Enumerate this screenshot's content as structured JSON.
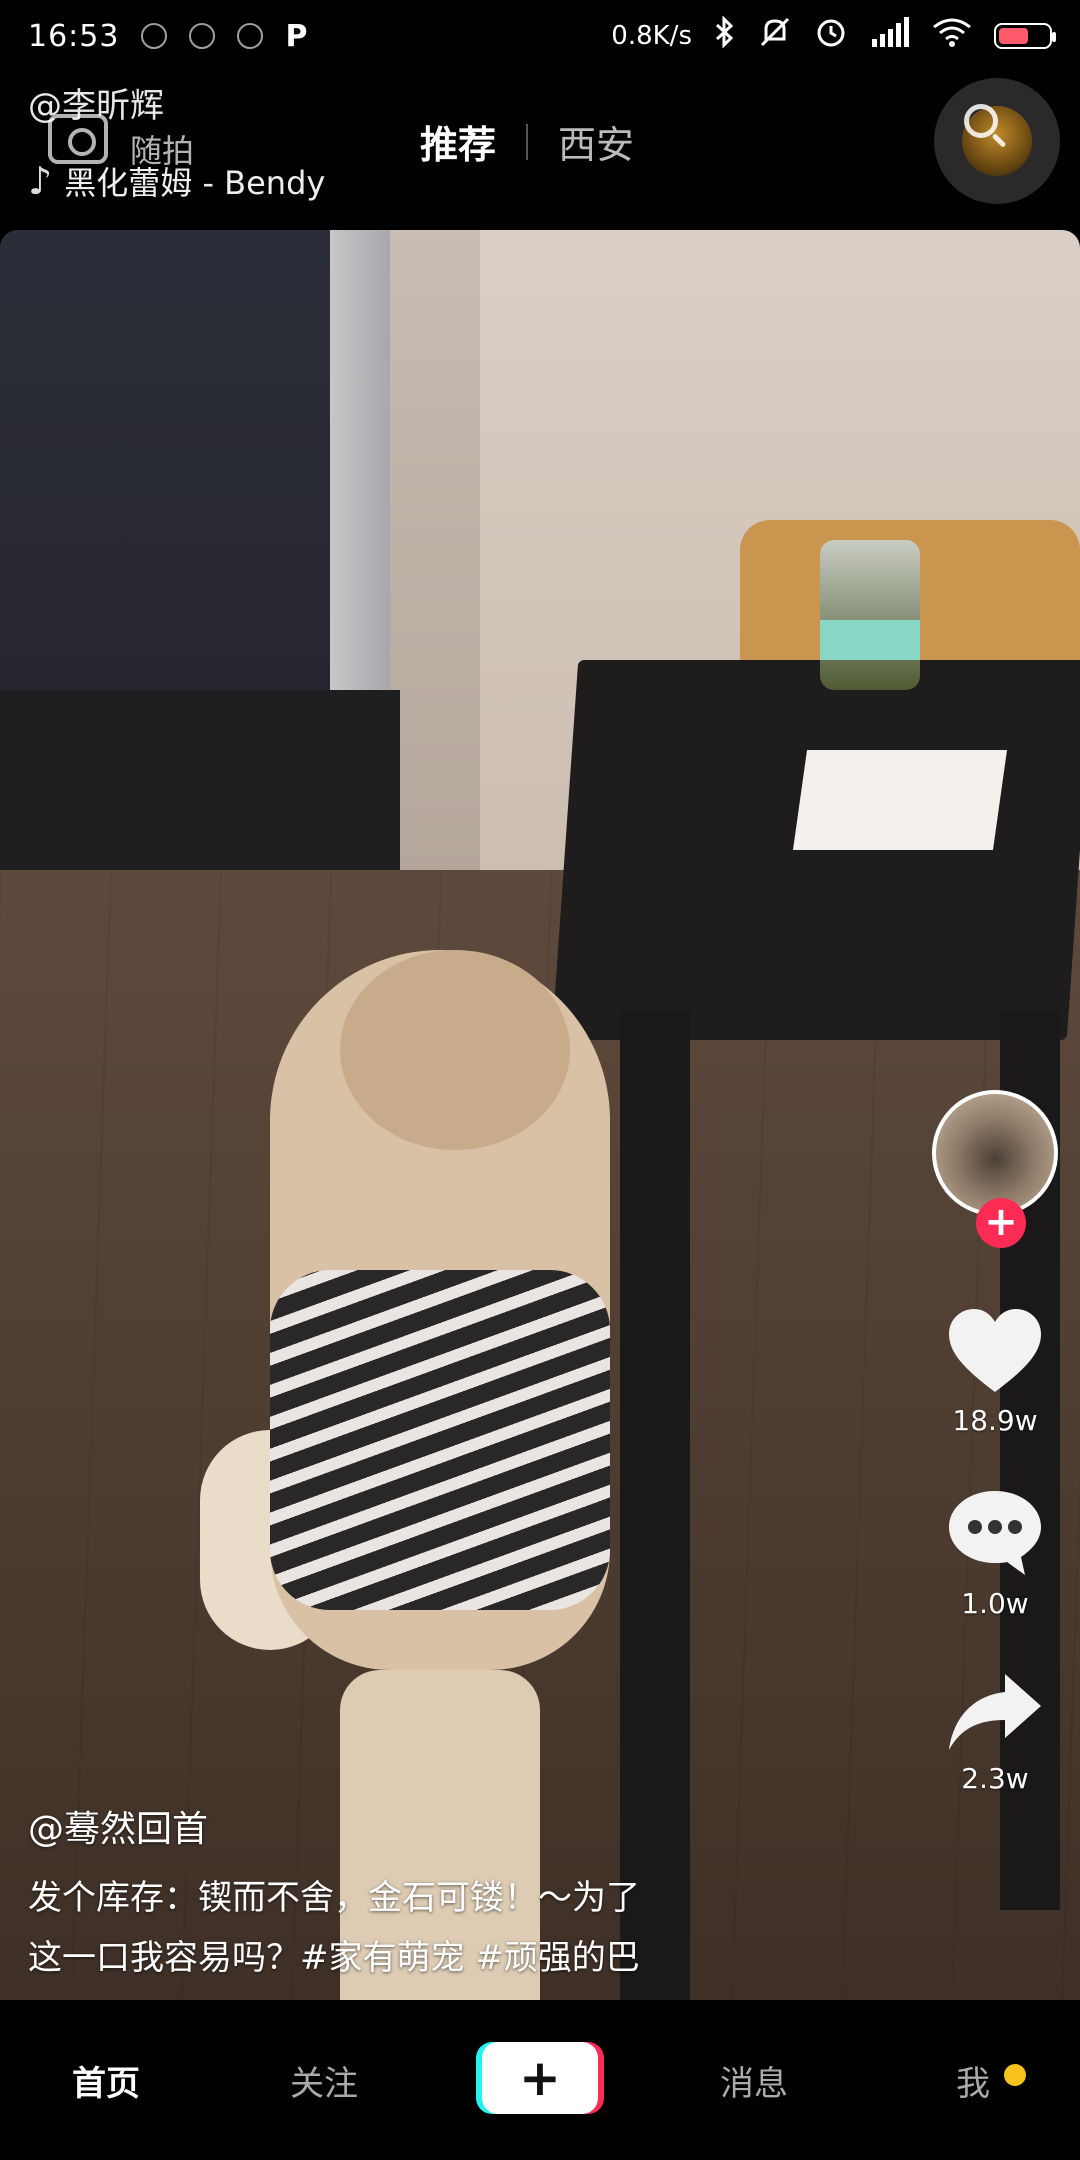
{
  "status_bar": {
    "time": "16:53",
    "net_speed": "0.8K/s",
    "battery_level": 0.6,
    "left_icons": [
      "app-icon-1",
      "app-icon-2",
      "app-icon-3",
      "p-app-icon"
    ],
    "right_icons": [
      "bluetooth-icon",
      "mute-icon",
      "alarm-icon",
      "signal-icon",
      "wifi-icon",
      "battery-icon"
    ]
  },
  "header": {
    "author": "@李昕辉",
    "shoot_label": "随拍",
    "music": "黑化蕾姆 - Bendy",
    "tabs": [
      {
        "label": "推荐",
        "active": true
      },
      {
        "label": "西安",
        "active": false
      }
    ]
  },
  "actions": {
    "likes": "18.9w",
    "comments": "1.0w",
    "shares": "2.3w",
    "follow_symbol": "+"
  },
  "caption": {
    "user": "@蓦然回首",
    "text": "发个库存：锲而不舍，金石可镂！～为了\n这一口我容易吗？#家有萌宠 #顽强的巴"
  },
  "bottom_nav": {
    "home": "首页",
    "follow": "关注",
    "create": "+",
    "messages": "消息",
    "me": "我",
    "accent_color": "#fe2c55",
    "secondary_color": "#25f4ee",
    "dot_color": "#f7c21c"
  }
}
